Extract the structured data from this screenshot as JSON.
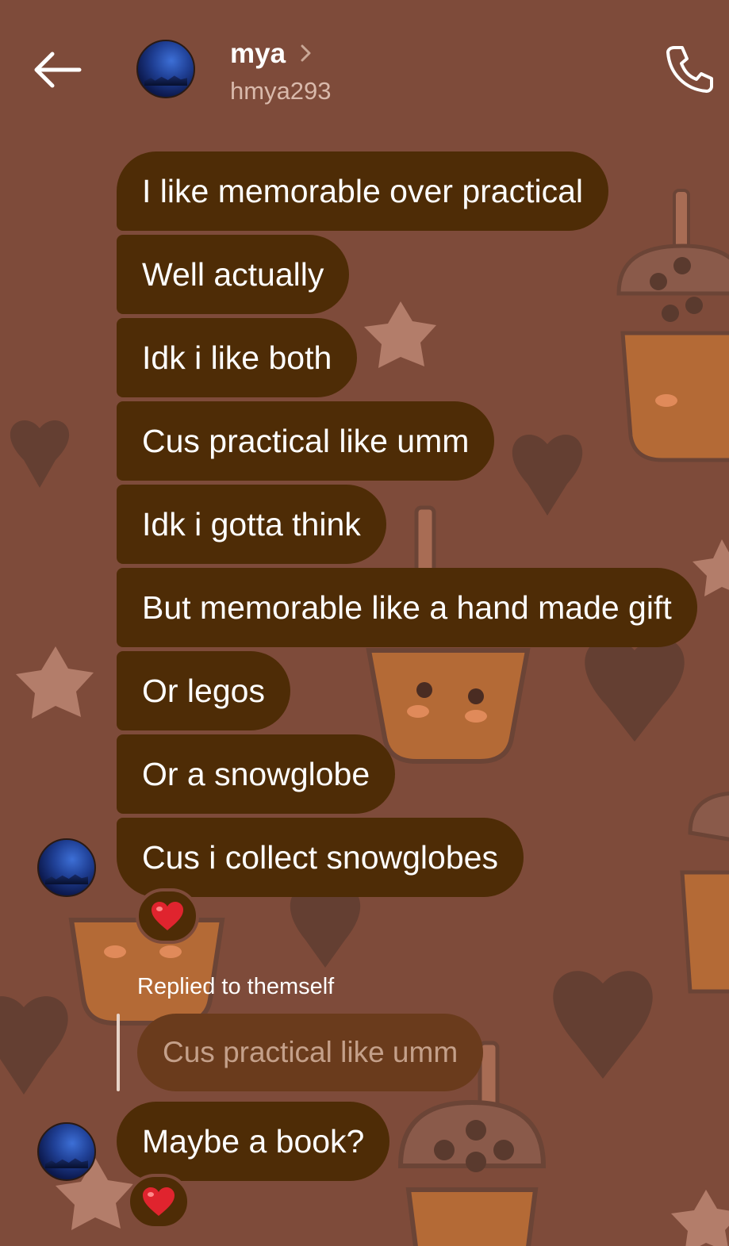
{
  "header": {
    "name": "mya",
    "handle": "hmya293",
    "back_icon": "arrow-left-icon",
    "call_icon": "phone-icon",
    "chevron_icon": "chevron-right-icon"
  },
  "messages": [
    {
      "text": "I like memorable over practical"
    },
    {
      "text": "Well actually"
    },
    {
      "text": "Idk i like both"
    },
    {
      "text": "Cus practical like umm"
    },
    {
      "text": "Idk i gotta think"
    },
    {
      "text": "But memorable like a hand made gift"
    },
    {
      "text": "Or legos"
    },
    {
      "text": "Or a snowglobe"
    },
    {
      "text": "Cus i collect snowglobes",
      "reaction": "heart"
    }
  ],
  "reply": {
    "label": "Replied to themself",
    "quoted": "Cus practical like umm",
    "text": "Maybe a book?",
    "reaction": "heart"
  },
  "colors": {
    "background": "#7e4b3a",
    "bubble": "#4e2c06",
    "reaction_heart": "#e0242e"
  }
}
